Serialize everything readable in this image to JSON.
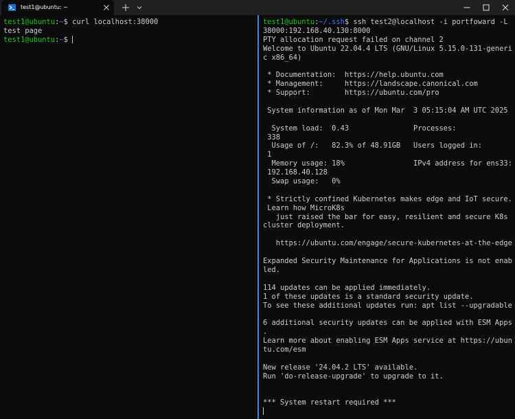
{
  "window": {
    "tab_title": "test1@ubuntu: ~",
    "tab_icon": "terminal-icon",
    "new_tab_icon": "plus-icon",
    "dropdown_icon": "chevron-down-icon",
    "controls": [
      "minimize-icon",
      "maximize-icon",
      "close-icon"
    ]
  },
  "colors": {
    "background": "#0c0c0c",
    "text": "#cccccc",
    "prompt_green": "#16c60c",
    "path_blue": "#3b78ff",
    "divider": "#3a86d8",
    "titlebar": "#202020"
  },
  "left_pane": {
    "line1": {
      "user": "test1@ubuntu",
      "colon": ":",
      "path": "~",
      "dollar": "$ ",
      "command": "curl localhost:38000"
    },
    "line2": "test page",
    "line3": {
      "user": "test1@ubuntu",
      "colon": ":",
      "path": "~",
      "dollar": "$ "
    }
  },
  "right_pane": {
    "prompt": {
      "user": "test1@ubuntu",
      "colon": ":",
      "path": "~/.ssh",
      "dollar": "$ ",
      "command": "ssh test2@localhost -i portfoward -L"
    },
    "lines": [
      "38000:192.168.40.130:8000",
      "PTY allocation request failed on channel 2",
      "Welcome to Ubuntu 22.04.4 LTS (GNU/Linux 5.15.0-131-generi",
      "c x86_64)",
      "",
      " * Documentation:  https://help.ubuntu.com",
      " * Management:     https://landscape.canonical.com",
      " * Support:        https://ubuntu.com/pro",
      "",
      " System information as of Mon Mar  3 05:15:04 AM UTC 2025",
      "",
      "  System load:  0.43               Processes:",
      " 338",
      "  Usage of /:   82.3% of 48.91GB   Users logged in:",
      " 1",
      "  Memory usage: 18%                IPv4 address for ens33:",
      " 192.168.40.128",
      "  Swap usage:   0%",
      "",
      " * Strictly confined Kubernetes makes edge and IoT secure.",
      " Learn how MicroK8s",
      "   just raised the bar for easy, resilient and secure K8s",
      "cluster deployment.",
      "",
      "   https://ubuntu.com/engage/secure-kubernetes-at-the-edge",
      "",
      "Expanded Security Maintenance for Applications is not enab",
      "led.",
      "",
      "114 updates can be applied immediately.",
      "1 of these updates is a standard security update.",
      "To see these additional updates run: apt list --upgradable",
      "",
      "6 additional security updates can be applied with ESM Apps",
      ".",
      "Learn more about enabling ESM Apps service at https://ubun",
      "tu.com/esm",
      "",
      "New release '24.04.2 LTS' available.",
      "Run 'do-release-upgrade' to upgrade to it.",
      "",
      "",
      "*** System restart required ***"
    ]
  }
}
